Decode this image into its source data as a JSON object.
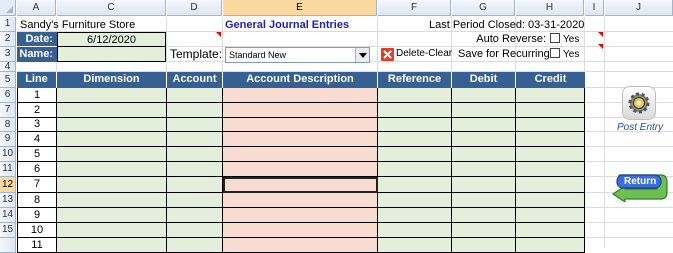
{
  "columns": [
    "A",
    "C",
    "D",
    "E",
    "F",
    "G",
    "H",
    "I",
    "J"
  ],
  "rows": [
    "1",
    "2",
    "3",
    "4",
    "5",
    "6",
    "7",
    "8",
    "9",
    "10",
    "11",
    "12",
    "13",
    "14",
    "15"
  ],
  "header": {
    "store_name": "Sandy's Furniture Store",
    "title": "General Journal Entries",
    "last_period": "Last Period Closed: 03-31-2020",
    "date_label": "Date:",
    "date_value": "6/12/2020",
    "name_label": "Name:",
    "name_value": "",
    "template_label": "Template:",
    "template_value": "Standard New",
    "delete_clear_label": "Delete-Clear",
    "auto_reverse_label": "Auto Reverse:",
    "auto_reverse_option": "Yes",
    "save_recurring_label": "Save for Recurring:",
    "save_recurring_option": "Yes"
  },
  "table": {
    "headers": [
      "Line",
      "Dimension",
      "Account",
      "Account Description",
      "Reference",
      "Debit",
      "Credit"
    ],
    "lines": [
      "1",
      "2",
      "3",
      "4",
      "5",
      "6",
      "7",
      "8",
      "9",
      "10",
      "11"
    ]
  },
  "side": {
    "post_entry_label": "Post Entry",
    "return_label": "Return"
  },
  "colors": {
    "header_blue": "#366092",
    "green_fill": "#e3efda",
    "pink_fill": "#f8dcd1",
    "title_blue": "#1f1fbf"
  }
}
